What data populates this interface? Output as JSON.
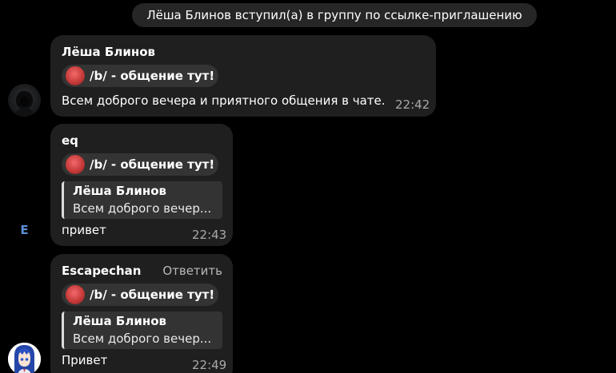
{
  "service_message": "Лёша Блинов вступил(а) в группу по ссылке-приглашению",
  "avatars": {
    "user2_letter": "E"
  },
  "messages": [
    {
      "sender": "Лёша Блинов",
      "chip": {
        "label": "/b/ - общение тут!",
        "chevron": "›"
      },
      "text": "Всем доброго вечера и приятного общения в чате.",
      "time": "22:42"
    },
    {
      "sender": "eq",
      "chip": {
        "label": "/b/ - общение тут!",
        "chevron": "›"
      },
      "quote": {
        "name": "Лёша Блинов",
        "text": "Всем доброго вечер..."
      },
      "text": "привет",
      "time": "22:43"
    },
    {
      "sender": "Escapechan",
      "reply_action": "Ответить",
      "chip": {
        "label": "/b/ - общение тут!",
        "chevron": "›"
      },
      "quote": {
        "name": "Лёша Блинов",
        "text": "Всем доброго вечер..."
      },
      "text": "Привет",
      "time": "22:49"
    }
  ],
  "colors": {
    "background": "#000000",
    "bubble": "#1f1f1f",
    "chip": "#343434",
    "quote": "#333333",
    "time": "#a9a9a9",
    "letter_avatar": "#5b8fd6"
  }
}
